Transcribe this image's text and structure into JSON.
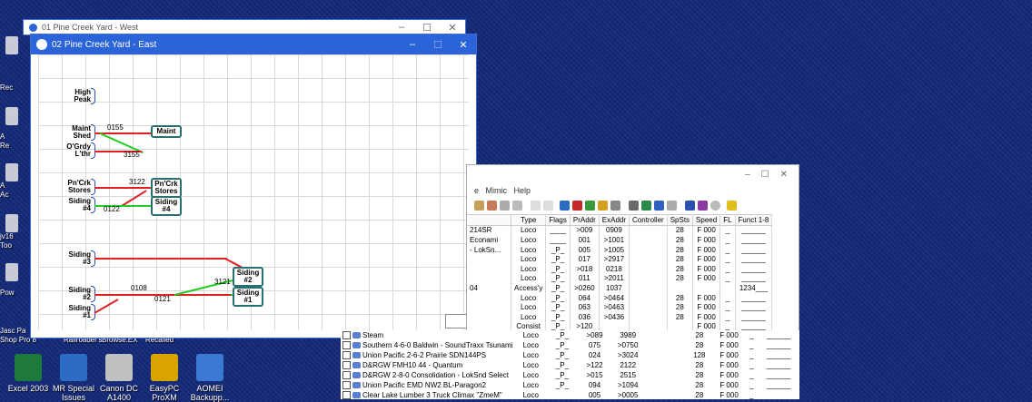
{
  "desktop": {
    "left_labels": [
      "Rec",
      "A",
      "Re",
      "A",
      "Ac",
      "jv16",
      "Too",
      "Pow",
      "Jasc Pa",
      "Shop Pro 8"
    ],
    "icons": [
      {
        "label": "Excel 2003",
        "color": "#1e7a3a"
      },
      {
        "label": "MR Special Issues",
        "color": "#2c6cc4"
      },
      {
        "label": "Canon DC A1400",
        "color": "#c0c0c0"
      },
      {
        "label": "EasyPC ProXM",
        "color": "#d9a400"
      },
      {
        "label": "AOMEI Backupp...",
        "color": "#3a7ad4"
      }
    ],
    "partial_labels": [
      "Railroader's",
      "Browse.EX",
      "Recalled"
    ]
  },
  "window_west": {
    "title": "01 Pine Creek Yard - West"
  },
  "window_east": {
    "title": "02 Pine Creek Yard - East",
    "labels": {
      "high_peak": "High\nPeak",
      "maint_shed": "Maint\nShed",
      "ogrdy": "O'Grdy\nL'thr",
      "pncrk_stores": "Pn'Crk\nStores",
      "siding4": "Siding\n#4",
      "siding3": "Siding\n#3",
      "siding2": "Siding\n#2",
      "siding1": "Siding\n#1"
    },
    "numbers": {
      "n0155": "0155",
      "n3155": "3155",
      "n3122": "3122",
      "n0122": "0122",
      "n0108": "0108",
      "n0121": "0121",
      "n3121": "3121"
    },
    "boxes": {
      "maint": "Maint",
      "pncrk": "Pn'Crk\nStores",
      "siding4": "Siding\n#4",
      "siding2": "Siding\n#2",
      "siding1": "Siding\n#1"
    }
  },
  "roster": {
    "menu": [
      "e",
      "Mimic",
      "Help"
    ],
    "headers": [
      "Type",
      "Flags",
      "PrAddr",
      "ExAddr",
      "Controller",
      "SpSts",
      "Speed",
      "FL",
      "Funct 1-8"
    ],
    "partial_names": [
      "214SR",
      "Econami",
      "- LokSn...",
      "",
      "",
      "",
      "04",
      "",
      "",
      "",
      ""
    ],
    "rows": [
      [
        "Loco",
        "____",
        ">009",
        "0909",
        "",
        "28",
        "F 000",
        "_",
        "______"
      ],
      [
        "Loco",
        "____",
        "001",
        ">1001",
        "",
        "28",
        "F 000",
        "_",
        "______"
      ],
      [
        "Loco",
        "_P_",
        "005",
        ">1005",
        "",
        "28",
        "F 000",
        "_",
        "______"
      ],
      [
        "Loco",
        "_P_",
        "017",
        ">2917",
        "",
        "28",
        "F 000",
        "_",
        "______"
      ],
      [
        "Loco",
        "_P_",
        ">018",
        "0218",
        "",
        "28",
        "F 000",
        "_",
        "______"
      ],
      [
        "Loco",
        "_P_",
        "011",
        ">2011",
        "",
        "28",
        "F 000",
        "_",
        "______"
      ],
      [
        "Access'y",
        "_P_",
        ">0260",
        "1037",
        "",
        "",
        "",
        "",
        "1234___"
      ],
      [
        "Loco",
        "_P_",
        "064",
        ">0464",
        "",
        "28",
        "F 000",
        "_",
        "______"
      ],
      [
        "Loco",
        "_P_",
        "063",
        ">0463",
        "",
        "28",
        "F 000",
        "_",
        "______"
      ],
      [
        "Loco",
        "_P_",
        "036",
        ">0436",
        "",
        "28",
        "F 000",
        "_",
        "______"
      ],
      [
        "Consist",
        "_P_",
        ">120",
        "",
        "",
        "",
        "F 000",
        "_",
        "______"
      ]
    ],
    "rows_full": [
      [
        "Steam",
        "Loco",
        "_P_",
        ">089",
        "3989",
        "",
        "28",
        "F 000",
        "_",
        "______"
      ],
      [
        "Southern 4-6-0 Baldwin - SoundTraxx Tsunami",
        "Loco",
        "_P_",
        "075",
        ">0750",
        "",
        "28",
        "F 000",
        "_",
        "______"
      ],
      [
        "Union Pacific 2-6-2 Prairie SDN144PS",
        "Loco",
        "_P_",
        "024",
        ">3024",
        "",
        "128",
        "F 000",
        "_",
        "______"
      ],
      [
        "D&RGW FMH10 44 - Quantum",
        "Loco",
        "_P_",
        ">122",
        "2122",
        "",
        "28",
        "F 000",
        "_",
        "______"
      ],
      [
        "D&RGW 2-8-0 Consolidation - LokSnd Select",
        "Loco",
        "_P_",
        ">015",
        "2515",
        "",
        "28",
        "F 000",
        "_",
        "______"
      ],
      [
        "Union Pacific EMD NW2 BL-Paragon2",
        "Loco",
        "_P_",
        "094",
        ">1094",
        "",
        "28",
        "F 000",
        "_",
        "______"
      ],
      [
        "Clear Lake Lumber 3 Truck Climax \"ZmeM\"",
        "Loco",
        "",
        "005",
        ">0005",
        "",
        "28",
        "F 000",
        "_",
        ""
      ]
    ]
  }
}
